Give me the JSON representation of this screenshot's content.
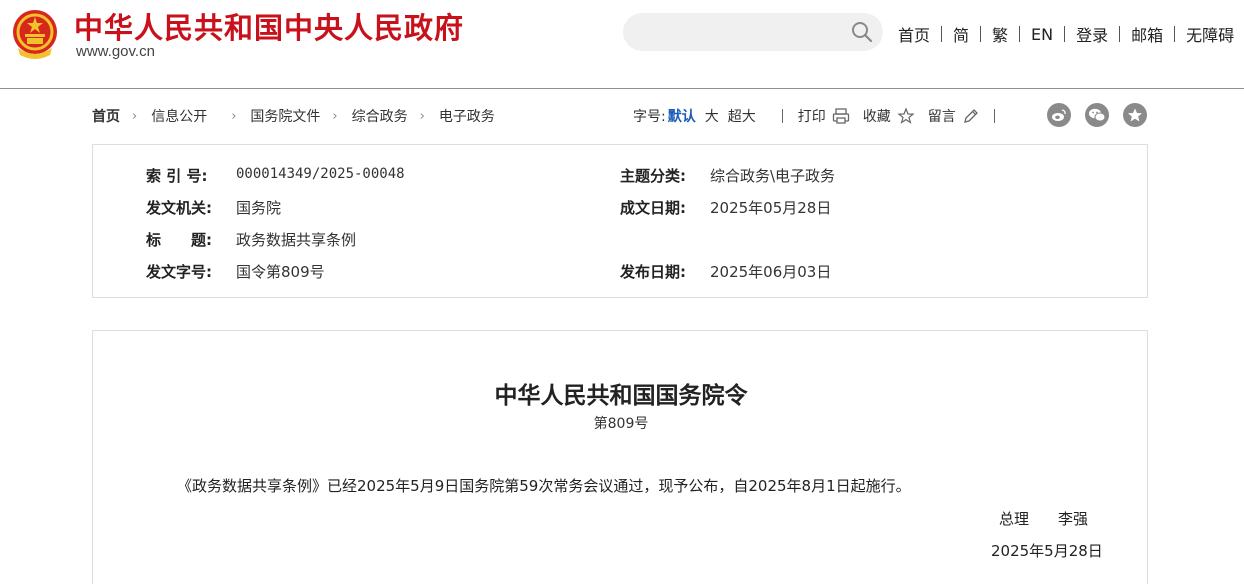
{
  "header": {
    "site_title": "中华人民共和国中央人民政府",
    "site_domain": "www.gov.cn",
    "search_placeholder": "",
    "nav": [
      "首页",
      "简",
      "繁",
      "EN",
      "登录",
      "邮箱",
      "无障碍"
    ],
    "brand_color": "#c8111a"
  },
  "breadcrumb": {
    "home": "首页",
    "items": [
      "信息公开",
      "国务院文件",
      "综合政务",
      "电子政务"
    ]
  },
  "tools": {
    "font_label": "字号:",
    "font_default": "默认",
    "font_large": "大",
    "font_xlarge": "超大",
    "print": "打印",
    "favorite": "收藏",
    "comment": "留言",
    "share_icons": [
      "weibo-icon",
      "wechat-icon",
      "star-share-icon"
    ],
    "accent_color": "#1a5bb8"
  },
  "info": {
    "index_label": "索 引 号:",
    "index_value": "000014349/2025-00048",
    "category_label": "主题分类:",
    "category_value": "综合政务\\电子政务",
    "issuer_label": "发文机关:",
    "issuer_value": "国务院",
    "created_label": "成文日期:",
    "created_value": "2025年05月28日",
    "title_label": "标　　题:",
    "title_value": "政务数据共享条例",
    "docno_label": "发文字号:",
    "docno_value": "国令第809号",
    "published_label": "发布日期:",
    "published_value": "2025年06月03日"
  },
  "document": {
    "title": "中华人民共和国国务院令",
    "number": "第809号",
    "body": "《政务数据共享条例》已经2025年5月9日国务院第59次常务会议通过，现予公布，自2025年8月1日起施行。",
    "sign_title": "总理",
    "sign_name": "李强",
    "date": "2025年5月28日"
  }
}
